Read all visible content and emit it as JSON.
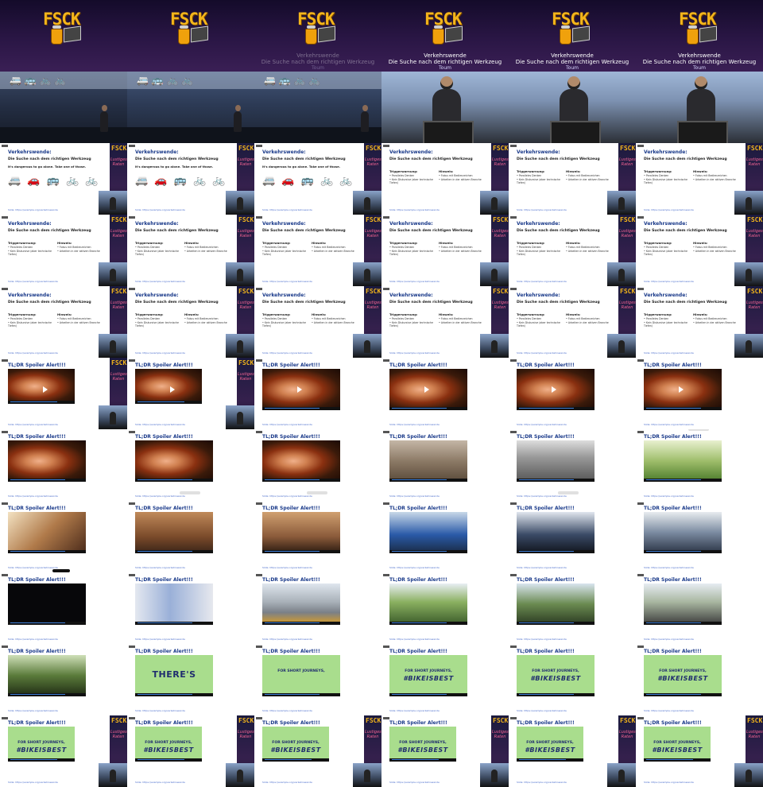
{
  "logo_text": "FSCK",
  "sidebar_logo": "FSCK",
  "sidebar_tag": "Lustiges Raten",
  "title_main": "Verkehrswende",
  "title_sub": "Die Suche nach dem richtigen Werkzeug",
  "speaker": "Toum",
  "slide_heading": "Verkehrswende:",
  "slide_subheading": "Die Suche nach dem richtigen Werkzeug",
  "slide_intro": "It's dangerous to go alone. Take one of those.",
  "icons_text": "🚐 🚗 🚌 🚲 🚲",
  "stage_vehicles": "🚐 🚌 🚲 🚲",
  "col1_heading": "Triggerwarnung:",
  "col1_items": [
    "• Paralleles Denken",
    "• Kein Diskursive (aber technische Tiefen)"
  ],
  "col2_heading": "Hinweis:",
  "col2_items": [
    "• Fokus mit Bedienzeichen",
    "• Arbeiten in der aktiven Branche"
  ],
  "footer_link": "Slide: https://example.org/verkehrswende",
  "video_heading": "TL;DR Spoiler Alert!!!",
  "green_big": "THERE'S",
  "green_short": "FOR SHORT JOURNEYS,",
  "green_hashtag": "#BIKEISBEST"
}
